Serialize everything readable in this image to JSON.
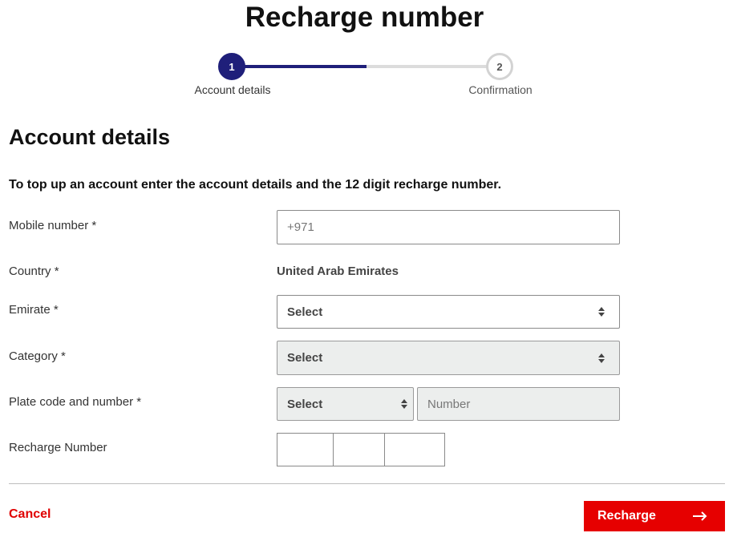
{
  "page": {
    "title": "Recharge number"
  },
  "stepper": {
    "progress": 0.5,
    "steps": [
      {
        "number": "1",
        "label": "Account details",
        "active": true
      },
      {
        "number": "2",
        "label": "Confirmation",
        "active": false
      }
    ]
  },
  "section": {
    "title": "Account details",
    "intro": "To top up an account enter the account details and the 12 digit recharge number."
  },
  "form": {
    "mobile": {
      "label": "Mobile number *",
      "placeholder": "+971"
    },
    "country": {
      "label": "Country *",
      "value": "United Arab Emirates"
    },
    "emirate": {
      "label": "Emirate *",
      "value": "Select"
    },
    "category": {
      "label": "Category *",
      "value": "Select"
    },
    "plate": {
      "label": "Plate code and number *",
      "code_value": "Select",
      "number_placeholder": "Number"
    },
    "recharge_number": {
      "label": "Recharge Number"
    }
  },
  "actions": {
    "cancel": "Cancel",
    "recharge": "Recharge"
  },
  "colors": {
    "primary": "#1f1f7a",
    "accent": "#e60000",
    "disabled_bg": "#eceeed"
  },
  "icons": {
    "arrow": "arrow-right-icon",
    "select": "select-arrows-icon"
  }
}
